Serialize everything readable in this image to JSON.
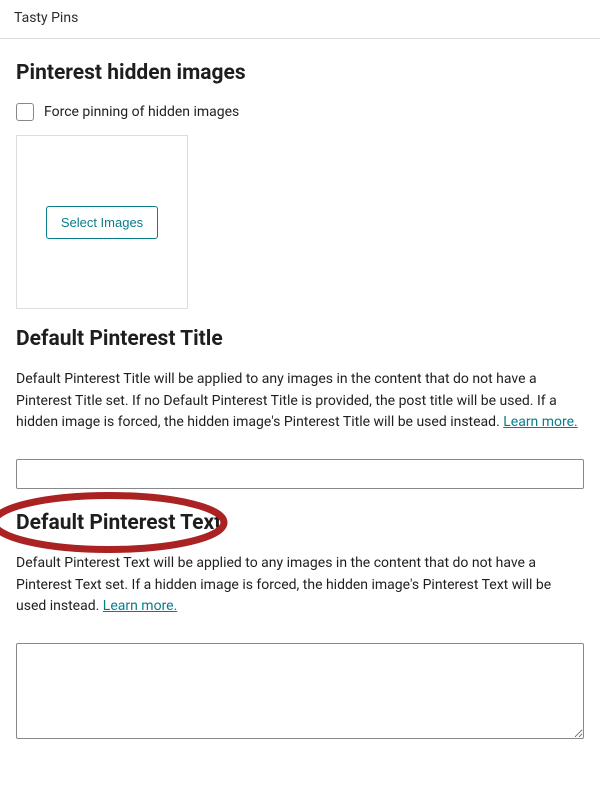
{
  "header": {
    "title": "Tasty Pins"
  },
  "hidden_images": {
    "heading": "Pinterest hidden images",
    "force_pin_label": "Force pinning of hidden images",
    "select_btn": "Select Images"
  },
  "pinterest_title": {
    "heading": "Default Pinterest Title",
    "description_1": "Default Pinterest Title will be applied to any images in the content that do not have a Pinterest Title set. If no Default Pinterest Title is provided, the post title will be used. If a hidden image is forced, the hidden image's Pinterest Title will be used instead. ",
    "learn_more": "Learn more.",
    "value": ""
  },
  "pinterest_text": {
    "heading": "Default Pinterest Text",
    "description_1": "Default Pinterest Text will be applied to any images in the content that do not have a Pinterest Text set. If a hidden image is forced, the hidden image's Pinterest Text will be used instead. ",
    "learn_more": "Learn more.",
    "value": ""
  }
}
